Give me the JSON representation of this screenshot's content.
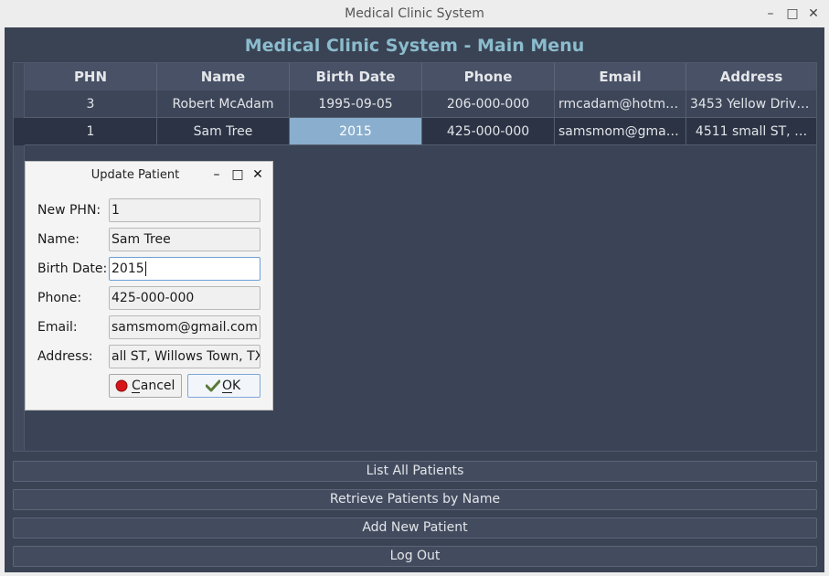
{
  "window": {
    "title": "Medical Clinic System"
  },
  "main": {
    "title": "Medical Clinic System - Main Menu"
  },
  "table": {
    "columns": [
      "PHN",
      "Name",
      "Birth Date",
      "Phone",
      "Email",
      "Address"
    ],
    "rows": [
      [
        "3",
        "Robert McAdam",
        "1995-09-05",
        "206-000-000",
        "rmcadam@hotma…",
        "3453 Yellow Drive…"
      ],
      [
        "1",
        "Sam Tree",
        "2015",
        "425-000-000",
        "samsmom@gmail…",
        "4511 small ST, …"
      ]
    ]
  },
  "buttons": {
    "list_all": "List All Patients",
    "retrieve": "Retrieve Patients by Name",
    "add_new": "Add New Patient",
    "logout": "Log Out"
  },
  "dialog": {
    "title": "Update Patient",
    "fields": [
      {
        "label": "New PHN:",
        "value": "1"
      },
      {
        "label": "Name:",
        "value": "Sam Tree"
      },
      {
        "label": "Birth Date:",
        "value": "2015"
      },
      {
        "label": "Phone:",
        "value": "425-000-000"
      },
      {
        "label": "Email:",
        "value": "samsmom@gmail.com"
      },
      {
        "label": "Address:",
        "value": "all ST, Willows Town, TX"
      }
    ],
    "cancel_label": "Cancel",
    "ok_label": "OK"
  },
  "icons": {
    "minimize": "minimize-icon",
    "maximize": "maximize-icon",
    "close": "close-icon",
    "cancel": "red-circle-icon",
    "ok": "checkmark-icon"
  },
  "colors": {
    "background": "#3a4354",
    "title": "#8bbccd",
    "selected_cell": "#8aaecd",
    "focus_border": "#6c9fd6"
  }
}
